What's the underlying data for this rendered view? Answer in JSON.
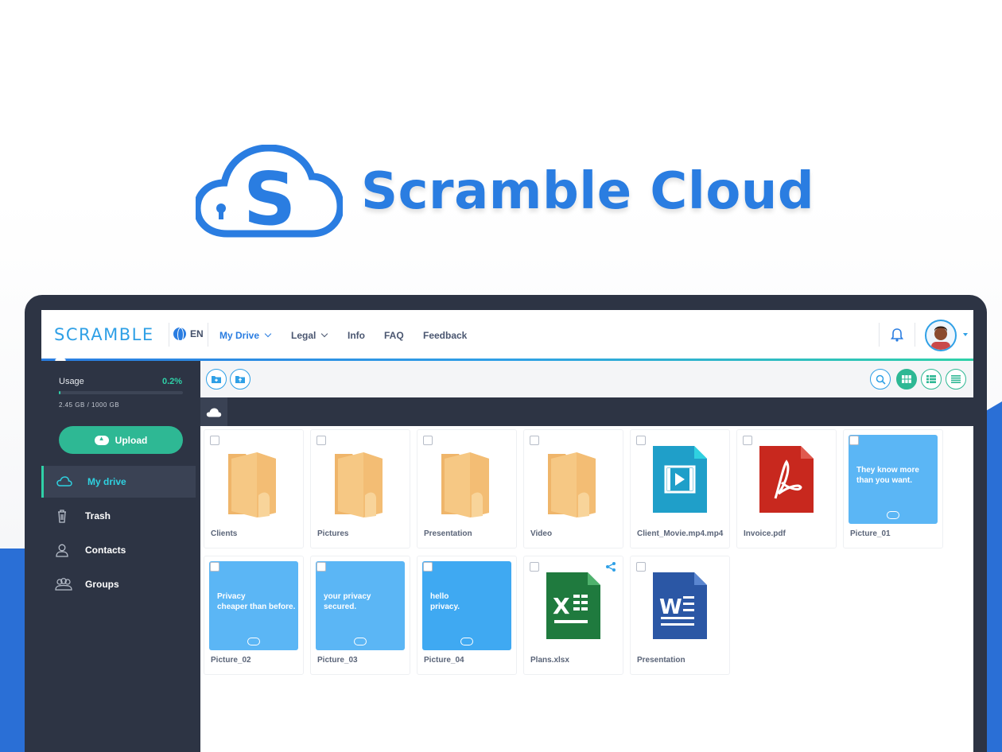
{
  "hero": {
    "brand_title": "Scramble Cloud",
    "brand_color": "#2a7de1"
  },
  "topnav": {
    "wordmark": "SCRAMBLE",
    "language": "EN",
    "items": [
      {
        "label": "My Drive",
        "has_dropdown": true,
        "active": true
      },
      {
        "label": "Legal",
        "has_dropdown": true,
        "active": false
      },
      {
        "label": "Info",
        "has_dropdown": false,
        "active": false
      },
      {
        "label": "FAQ",
        "has_dropdown": false,
        "active": false
      },
      {
        "label": "Feedback",
        "has_dropdown": false,
        "active": false
      }
    ],
    "icons": [
      "globe-icon",
      "bell-icon",
      "avatar"
    ]
  },
  "sidebar": {
    "usage_label": "Usage",
    "usage_percent": "0.2%",
    "usage_fraction": 0.002,
    "usage_size": "2.45 GB  /  1000 GB",
    "upload_label": "Upload",
    "items": [
      {
        "label": "My drive",
        "icon": "cloud-icon",
        "active": true
      },
      {
        "label": "Trash",
        "icon": "trash-icon",
        "active": false
      },
      {
        "label": "Contacts",
        "icon": "contact-icon",
        "active": false
      },
      {
        "label": "Groups",
        "icon": "groups-icon",
        "active": false
      }
    ]
  },
  "toolbar": {
    "left_buttons": [
      "new-folder-icon",
      "upload-folder-icon"
    ],
    "right_buttons": [
      "search-icon",
      "grid-view-icon",
      "list-view-icon",
      "compact-list-icon"
    ],
    "active_view": "grid"
  },
  "breadcrumb": {
    "home_icon": "cloud-icon"
  },
  "files": [
    {
      "name": "Clients",
      "type": "folder"
    },
    {
      "name": "Pictures",
      "type": "folder"
    },
    {
      "name": "Presentation",
      "type": "folder"
    },
    {
      "name": "Video",
      "type": "folder"
    },
    {
      "name": "Client_Movie.mp4.mp4",
      "type": "video"
    },
    {
      "name": "Invoice.pdf",
      "type": "pdf"
    },
    {
      "name": "Picture_01",
      "type": "image",
      "caption": "They know more\nthan you want.",
      "color": "#5bb6f5"
    },
    {
      "name": "Picture_02",
      "type": "image",
      "caption": "Privacy\ncheaper than before.",
      "color": "#5bb6f5"
    },
    {
      "name": "Picture_03",
      "type": "image",
      "caption": "your privacy\nsecured.",
      "color": "#5bb6f5"
    },
    {
      "name": "Picture_04",
      "type": "image",
      "caption": "hello\nprivacy.",
      "color": "#3fa9f2"
    },
    {
      "name": "Plans.xlsx",
      "type": "excel",
      "shared": true
    },
    {
      "name": "Presentation",
      "type": "word"
    }
  ],
  "colors": {
    "accent_blue": "#2a7de1",
    "accent_green": "#2eb894",
    "sidebar_bg": "#2d3444",
    "folder": "#f6c884"
  }
}
